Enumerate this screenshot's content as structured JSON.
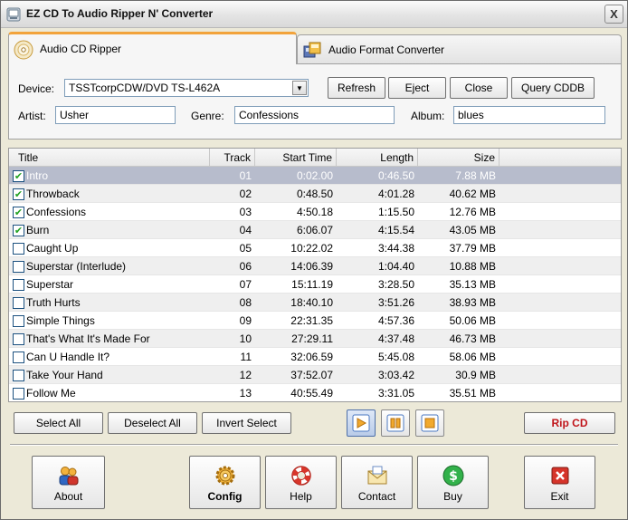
{
  "window": {
    "title": "EZ CD To Audio Ripper N' Converter",
    "close_glyph": "X"
  },
  "tabs": [
    {
      "label": "Audio CD Ripper",
      "icon": "cd-icon"
    },
    {
      "label": "Audio Format Converter",
      "icon": "converter-icon"
    }
  ],
  "form": {
    "device_label": "Device:",
    "device_value": "TSSTcorpCDW/DVD TS-L462A",
    "artist_label": "Artist:",
    "artist_value": "Usher",
    "genre_label": "Genre:",
    "genre_value": "Confessions",
    "album_label": "Album:",
    "album_value": "blues"
  },
  "top_buttons": {
    "refresh": "Refresh",
    "eject": "Eject",
    "close": "Close",
    "query": "Query CDDB"
  },
  "columns": {
    "title": "Title",
    "track": "Track",
    "start": "Start Time",
    "length": "Length",
    "size": "Size"
  },
  "tracks": [
    {
      "title": "Intro",
      "track": "01",
      "start": "0:02.00",
      "length": "0:46.50",
      "size": "7.88 MB",
      "checked": true
    },
    {
      "title": "Throwback",
      "track": "02",
      "start": "0:48.50",
      "length": "4:01.28",
      "size": "40.62 MB",
      "checked": true
    },
    {
      "title": "Confessions",
      "track": "03",
      "start": "4:50.18",
      "length": "1:15.50",
      "size": "12.76 MB",
      "checked": true
    },
    {
      "title": "Burn",
      "track": "04",
      "start": "6:06.07",
      "length": "4:15.54",
      "size": "43.05 MB",
      "checked": true
    },
    {
      "title": "Caught Up",
      "track": "05",
      "start": "10:22.02",
      "length": "3:44.38",
      "size": "37.79 MB",
      "checked": false
    },
    {
      "title": "Superstar (Interlude)",
      "track": "06",
      "start": "14:06.39",
      "length": "1:04.40",
      "size": "10.88 MB",
      "checked": false
    },
    {
      "title": "Superstar",
      "track": "07",
      "start": "15:11.19",
      "length": "3:28.50",
      "size": "35.13 MB",
      "checked": false
    },
    {
      "title": "Truth Hurts",
      "track": "08",
      "start": "18:40.10",
      "length": "3:51.26",
      "size": "38.93 MB",
      "checked": false
    },
    {
      "title": "Simple Things",
      "track": "09",
      "start": "22:31.35",
      "length": "4:57.36",
      "size": "50.06 MB",
      "checked": false
    },
    {
      "title": "That's What It's Made For",
      "track": "10",
      "start": "27:29.11",
      "length": "4:37.48",
      "size": "46.73 MB",
      "checked": false
    },
    {
      "title": "Can U Handle It?",
      "track": "11",
      "start": "32:06.59",
      "length": "5:45.08",
      "size": "58.06 MB",
      "checked": false
    },
    {
      "title": "Take Your Hand",
      "track": "12",
      "start": "37:52.07",
      "length": "3:03.42",
      "size": "30.9 MB",
      "checked": false
    },
    {
      "title": "Follow Me",
      "track": "13",
      "start": "40:55.49",
      "length": "3:31.05",
      "size": "35.51 MB",
      "checked": false
    }
  ],
  "selection_buttons": {
    "select_all": "Select All",
    "deselect_all": "Deselect All",
    "invert": "Invert Select"
  },
  "rip_label": "Rip CD",
  "bottom_buttons": {
    "about": "About",
    "config": "Config",
    "help": "Help",
    "contact": "Contact",
    "buy": "Buy",
    "exit": "Exit"
  },
  "colors": {
    "rip": "#c0151b",
    "tab_accent": "#f2a33b",
    "selected_row": "#b7bccc"
  }
}
